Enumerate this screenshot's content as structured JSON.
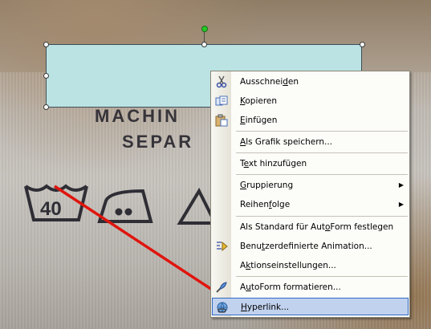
{
  "background": {
    "label_lines": [
      "MACHIN",
      "SEPAR"
    ],
    "wash_temperature": "40"
  },
  "context_menu": {
    "items": [
      {
        "pre": "Ausschnei",
        "key": "d",
        "post": "en",
        "icon": "scissors-icon"
      },
      {
        "pre": "",
        "key": "K",
        "post": "opieren",
        "icon": "copy-icon"
      },
      {
        "pre": "",
        "key": "E",
        "post": "infügen",
        "icon": "paste-icon"
      },
      {
        "pre": "",
        "key": "A",
        "post": "ls Grafik speichern...",
        "icon": ""
      },
      {
        "pre": "T",
        "key": "e",
        "post": "xt hinzufügen",
        "icon": ""
      },
      {
        "pre": "",
        "key": "G",
        "post": "ruppierung",
        "icon": "",
        "submenu": true
      },
      {
        "pre": "Reihen",
        "key": "f",
        "post": "olge",
        "icon": "",
        "submenu": true
      },
      {
        "pre": "Als Standard für Aut",
        "key": "o",
        "post": "Form festlegen",
        "icon": ""
      },
      {
        "pre": "Benu",
        "key": "t",
        "post": "zerdefinierte Animation...",
        "icon": "animation-icon"
      },
      {
        "pre": "A",
        "key": "k",
        "post": "tionseinstellungen...",
        "icon": ""
      },
      {
        "pre": "A",
        "key": "u",
        "post": "toForm formatieren...",
        "icon": "format-shape-icon"
      },
      {
        "pre": "",
        "key": "H",
        "post": "yperlink...",
        "icon": "hyperlink-icon",
        "highlighted": true
      }
    ],
    "submenu_arrow": "▶"
  },
  "annotation": {
    "arrow_color": "#e0140c"
  },
  "shape": {
    "fill_color": "#bce3e3",
    "rotation_handle_color": "#22cc22"
  }
}
